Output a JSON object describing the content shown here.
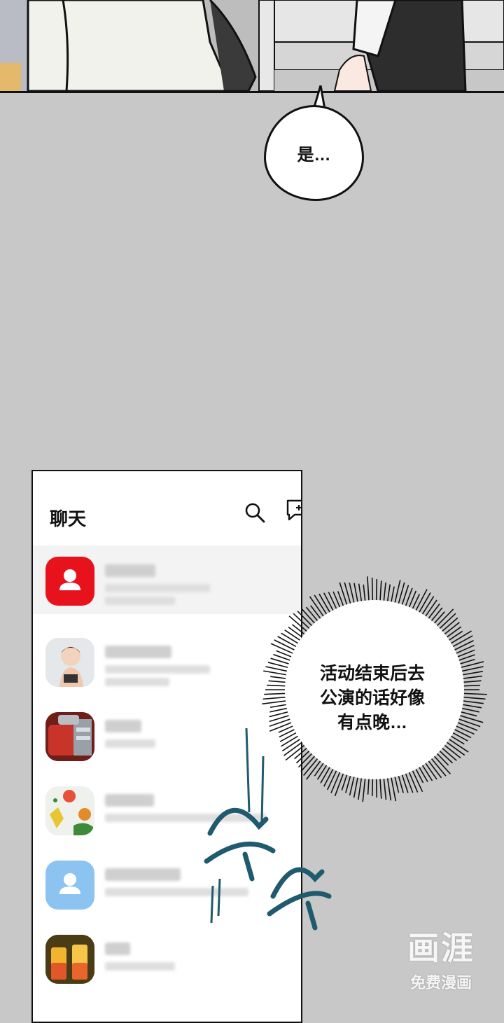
{
  "speech_bubble": {
    "text": "是…"
  },
  "phone": {
    "title": "聊天",
    "chats": [
      {
        "avatar": "red-person-avatar"
      },
      {
        "avatar": "robot-figure-photo-avatar"
      },
      {
        "avatar": "red-machine-photo-avatar"
      },
      {
        "avatar": "toys-photo-avatar"
      },
      {
        "avatar": "blue-person-avatar"
      },
      {
        "avatar": "drinks-photo-avatar"
      }
    ]
  },
  "thought_burst": {
    "line1": "活动结束后去",
    "line2": "公演的话好像",
    "line3": "有点晚…"
  },
  "watermark": {
    "logo": "画涯",
    "subtitle": "免费漫画"
  },
  "colors": {
    "background": "#c8c8c8",
    "red_avatar": "#e8121d",
    "blue_avatar": "#8cc3f0",
    "sfx": "#1f5a6e"
  }
}
